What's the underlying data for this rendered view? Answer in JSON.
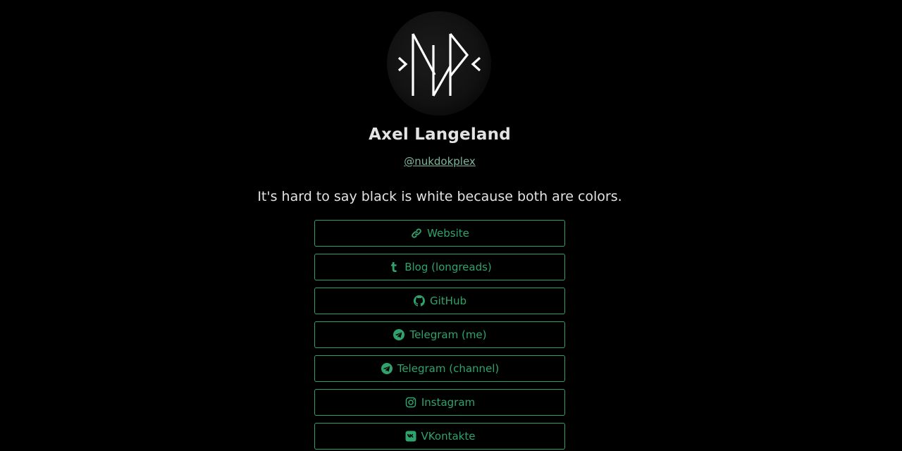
{
  "profile": {
    "name": "Axel Langeland",
    "handle": "@nukdokplex",
    "bio": "It's hard to say black is white because both are colors."
  },
  "links": [
    {
      "label": "Website",
      "icon": "link-icon"
    },
    {
      "label": "Blog (longreads)",
      "icon": "tumblr-icon"
    },
    {
      "label": "GitHub",
      "icon": "github-icon"
    },
    {
      "label": "Telegram (me)",
      "icon": "telegram-icon"
    },
    {
      "label": "Telegram (channel)",
      "icon": "telegram-icon"
    },
    {
      "label": "Instagram",
      "icon": "instagram-icon"
    },
    {
      "label": "VKontakte",
      "icon": "vk-icon"
    }
  ],
  "colors": {
    "background": "#000000",
    "accent": "#2fa36c",
    "text": "#e3e3e3",
    "handle": "#7fb59b"
  }
}
